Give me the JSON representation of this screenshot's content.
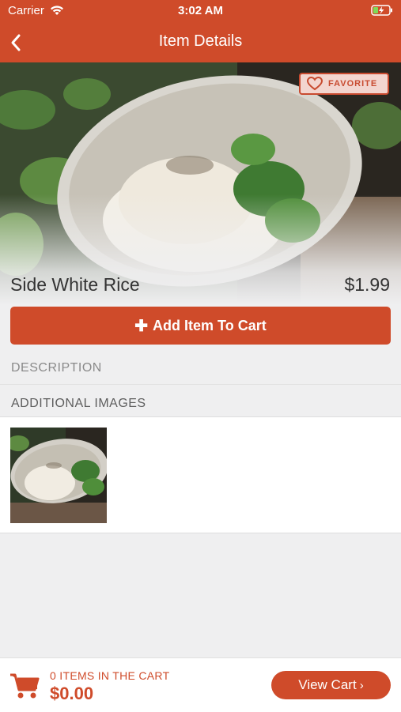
{
  "status_bar": {
    "carrier": "Carrier",
    "time": "3:02 AM"
  },
  "nav": {
    "title": "Item Details",
    "back_icon": "chevron-left-icon"
  },
  "hero": {
    "favorite_label": "FAVORITE",
    "favorite_icon": "heart-outline-icon"
  },
  "item": {
    "name": "Side White Rice",
    "price": "$1.99"
  },
  "actions": {
    "add_to_cart_label": "Add Item To Cart",
    "add_icon": "plus-icon"
  },
  "sections": {
    "description": "DESCRIPTION",
    "additional_images": "ADDITIONAL IMAGES"
  },
  "cart": {
    "count_text": "0 ITEMS IN THE CART",
    "total": "$0.00",
    "view_cart_label": "View Cart",
    "view_cart_icon": "chevron-right-icon",
    "cart_icon": "shopping-cart-icon"
  },
  "colors": {
    "accent": "#cf4b2a",
    "background": "#efeff0"
  }
}
